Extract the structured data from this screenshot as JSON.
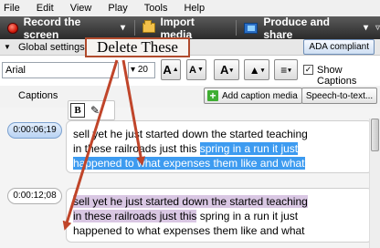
{
  "menubar": {
    "items": [
      "File",
      "Edit",
      "View",
      "Play",
      "Tools",
      "Help"
    ]
  },
  "toolbar": {
    "record": "Record the screen",
    "record_chevron": "▾",
    "import": "Import media",
    "produce": "Produce and share",
    "produce_chevron": "▾",
    "more": "▿"
  },
  "settings": {
    "label": "Global settings",
    "ada": "ADA compliant"
  },
  "font": {
    "family": "Arial",
    "size": "20",
    "chevron": "▾"
  },
  "show_captions": {
    "label": "Show Captions",
    "checked": true
  },
  "captions": {
    "label": "Captions",
    "add_button": "Add caption media",
    "speech_button": "Speech-to-text..."
  },
  "format": {
    "bold": "B",
    "pen": "✎"
  },
  "entries": [
    {
      "time": "0:00:06;19",
      "lines": [
        "sell yet he just started down the started teaching",
        "in these railroads just this spring in a run it just",
        "happened to what expenses them like and what"
      ]
    },
    {
      "time": "0:00:12;08",
      "lines": [
        "sell yet he just started down the started teaching",
        "in these railroads just this spring in a run it just",
        "happened to what expenses them like and what"
      ]
    }
  ],
  "entry_a_parts": {
    "line1": "sell yet he just started down the started teaching",
    "line2_plain": "in these railroads just this ",
    "line2_hl": "spring in a run it just",
    "line3_hl": "happened to what expenses them like and what"
  },
  "entry_b_parts": {
    "line1_hl": "sell yet he just started down the started teaching",
    "line2_hl": "in these railroads just this",
    "line2_plain": " spring in a run it just",
    "line3": "happened to what expenses them like and what"
  },
  "annotation": {
    "label": "Delete These",
    "color": "#c0452a"
  },
  "colors": {
    "selection_blue": "#3d9bf0",
    "selection_pink": "#d9c7e3",
    "arrow": "#c0452a"
  }
}
